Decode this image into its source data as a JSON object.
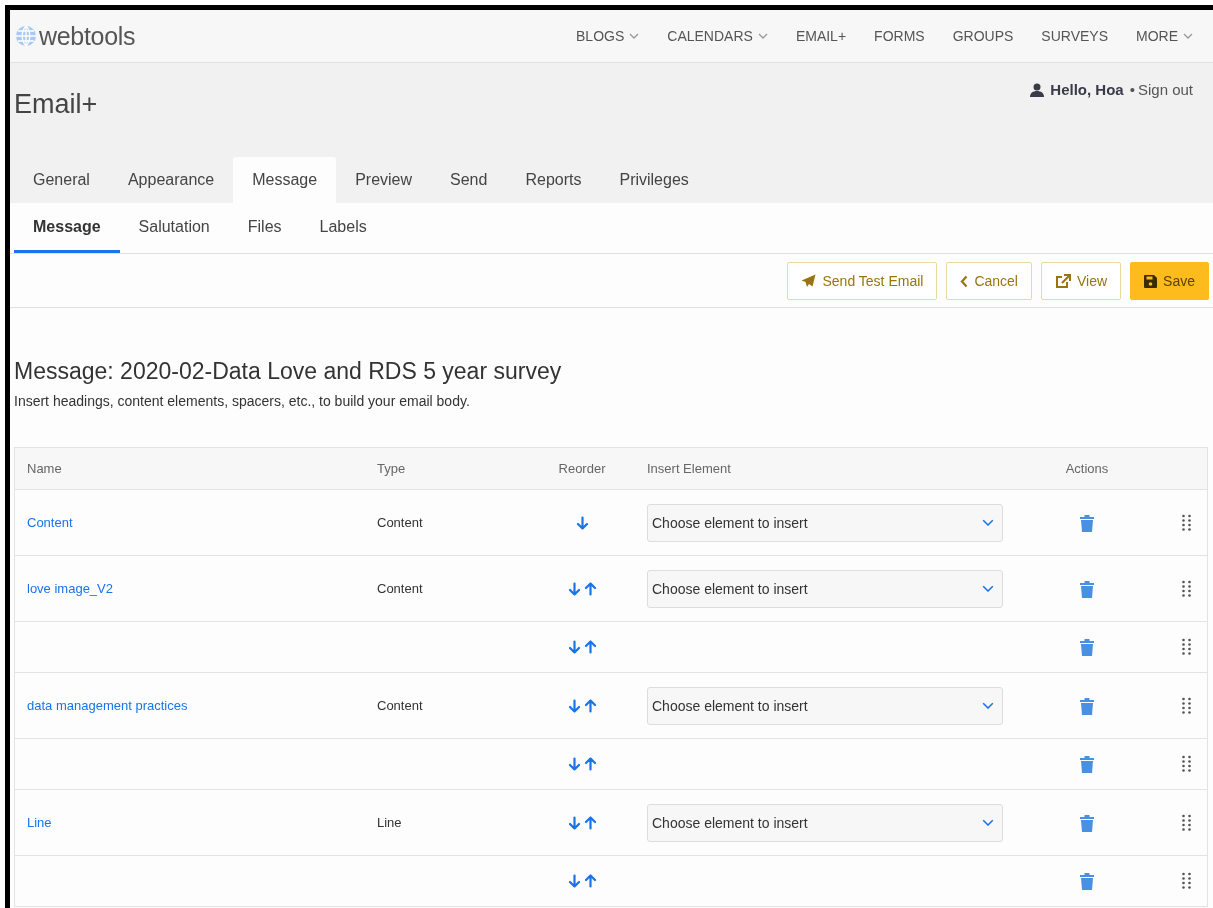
{
  "brand": "webtools",
  "nav": [
    {
      "label": "BLOGS",
      "dropdown": true
    },
    {
      "label": "CALENDARS",
      "dropdown": true
    },
    {
      "label": "EMAIL+",
      "dropdown": false
    },
    {
      "label": "FORMS",
      "dropdown": false
    },
    {
      "label": "GROUPS",
      "dropdown": false
    },
    {
      "label": "SURVEYS",
      "dropdown": false
    },
    {
      "label": "MORE",
      "dropdown": true
    }
  ],
  "page_title": "Email+",
  "user": {
    "greeting": "Hello, Hoa",
    "separator": "•",
    "sign_out": "Sign out"
  },
  "tabs": [
    {
      "label": "General",
      "selected": false
    },
    {
      "label": "Appearance",
      "selected": false
    },
    {
      "label": "Message",
      "selected": true
    },
    {
      "label": "Preview",
      "selected": false
    },
    {
      "label": "Send",
      "selected": false
    },
    {
      "label": "Reports",
      "selected": false
    },
    {
      "label": "Privileges",
      "selected": false
    }
  ],
  "subtabs": [
    {
      "label": "Message",
      "selected": true
    },
    {
      "label": "Salutation",
      "selected": false
    },
    {
      "label": "Files",
      "selected": false
    },
    {
      "label": "Labels",
      "selected": false
    }
  ],
  "actions": [
    {
      "kind": "send",
      "label": "Send Test Email"
    },
    {
      "kind": "cancel",
      "label": "Cancel"
    },
    {
      "kind": "view",
      "label": "View"
    },
    {
      "kind": "save",
      "label": "Save"
    }
  ],
  "heading": "Message: 2020-02-Data Love and RDS 5 year survey",
  "description": "Insert headings, content elements, spacers, etc., to build your email body.",
  "table": {
    "columns": [
      "Name",
      "Type",
      "Reorder",
      "Insert Element",
      "Actions"
    ],
    "rows": [
      {
        "kind": "element",
        "name": "Content",
        "type": "Content",
        "down": true,
        "up": false,
        "placeholder": "Choose element to insert"
      },
      {
        "kind": "element",
        "name": "love image_V2",
        "type": "Content",
        "down": true,
        "up": true,
        "placeholder": "Choose element to insert"
      },
      {
        "kind": "spacer",
        "down": true,
        "up": true
      },
      {
        "kind": "element",
        "name": "data management practices",
        "type": "Content",
        "down": true,
        "up": true,
        "placeholder": "Choose element to insert"
      },
      {
        "kind": "spacer",
        "down": true,
        "up": true
      },
      {
        "kind": "element",
        "name": "Line",
        "type": "Line",
        "down": true,
        "up": true,
        "placeholder": "Choose element to insert"
      },
      {
        "kind": "spacer",
        "down": true,
        "up": true
      }
    ]
  }
}
